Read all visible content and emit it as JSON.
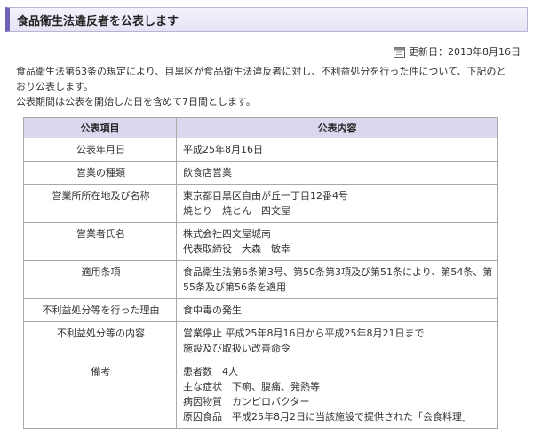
{
  "header": {
    "title": "食品衛生法違反者を公表します"
  },
  "meta": {
    "updated": "更新日：2013年8月16日"
  },
  "intro": {
    "lines": [
      "食品衛生法第63条の規定により、目黒区が食品衛生法違反者に対し、不利益処分を行った件について、下記のと",
      "おり公表します。",
      "公表期間は公表を開始した日を含めて7日間とします。"
    ]
  },
  "table": {
    "headers": [
      "公表項目",
      "公表内容"
    ],
    "rows": [
      {
        "item": "公表年月日",
        "values": [
          "平成25年8月16日"
        ]
      },
      {
        "item": "営業の種類",
        "values": [
          "飲食店営業"
        ]
      },
      {
        "item": "営業所所在地及び名称",
        "values": [
          "東京都目黒区自由が丘一丁目12番4号",
          "焼とり　焼とん　四文屋"
        ]
      },
      {
        "item": "営業者氏名",
        "values": [
          "株式会社四文屋城南",
          "代表取締役　大森　敏幸"
        ]
      },
      {
        "item": "適用条項",
        "values": [
          "食品衛生法第6条第3号、第50条第3項及び第51条により、第54条、第",
          "55条及び第56条を適用"
        ]
      },
      {
        "item": "不利益処分等を行った理由",
        "values": [
          "食中毒の発生"
        ]
      },
      {
        "item": "不利益処分等の内容",
        "values": [
          "営業停止 平成25年8月16日から平成25年8月21日まで",
          "施設及び取扱い改善命令"
        ]
      },
      {
        "item": "備考",
        "values": [
          "患者数　4人",
          "主な症状　下痢、腹痛、発熱等",
          "病因物質　カンピロバクター",
          "原因食品　平成25年8月2日に当該施設で提供された「会食料理」"
        ]
      }
    ]
  },
  "icons": {
    "updated": "calendar-icon"
  },
  "colors": {
    "header_accent": "#6e63b5",
    "table_header_bg": "#dad8ef"
  }
}
